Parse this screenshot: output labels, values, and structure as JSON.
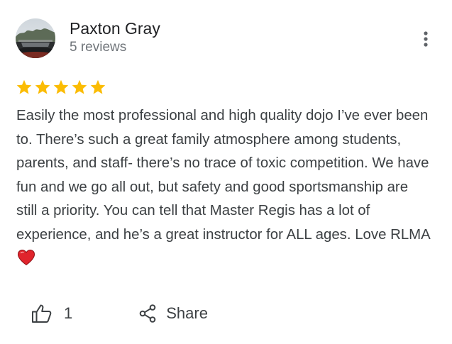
{
  "reviewer": {
    "name": "Paxton Gray",
    "review_count": "5 reviews",
    "avatar": "profile-photo"
  },
  "rating": {
    "stars": 5,
    "max": 5,
    "star_color": "#fbbc04"
  },
  "review": {
    "text": "Easily the most professional and high quality dojo I’ve ever been to. There’s such a great family atmosphere among students, parents, and staff- there’s no trace of toxic competition. We have fun and we go all out, but safety and good sportsmanship are still a priority. You can tell that Master Regis has a lot of experience, and he’s a great instructor for ALL ages. Love RLMA",
    "emoji": "heart-icon",
    "emoji_color": "#e0242c"
  },
  "actions": {
    "like_count": "1",
    "share_label": "Share"
  },
  "icons": {
    "menu": "more-vert-icon",
    "like": "thumbs-up-icon",
    "share": "share-icon"
  },
  "colors": {
    "text_primary": "#202124",
    "text_secondary": "#70757a",
    "body_text": "#3c4043"
  }
}
